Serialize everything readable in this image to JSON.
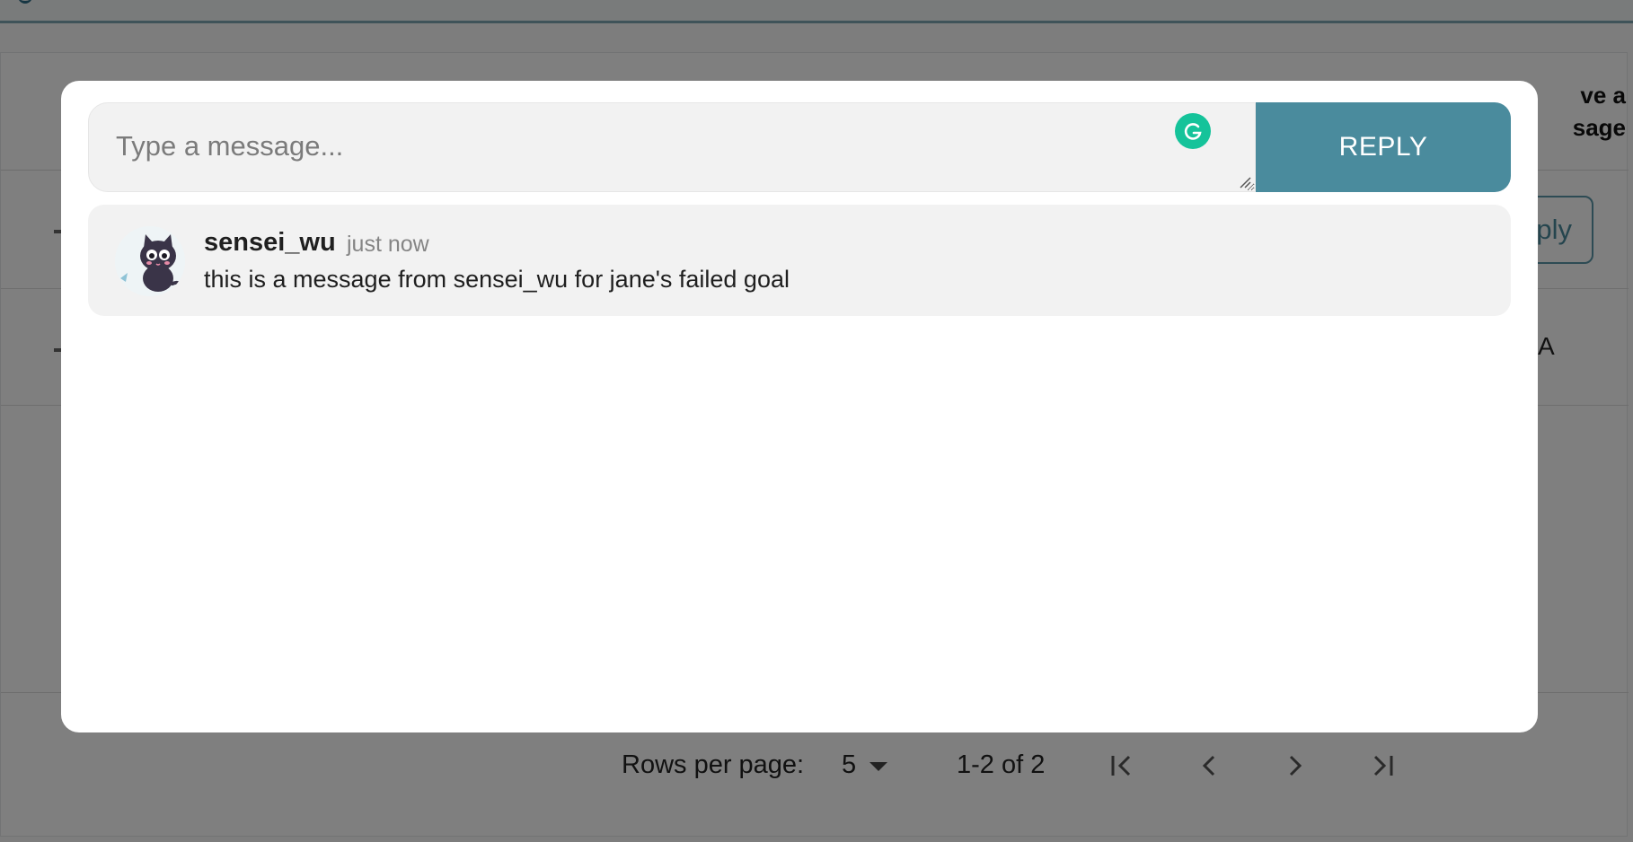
{
  "background": {
    "header_text": "ve a\nsage",
    "row_action_label": "ply",
    "row_cell_value": "A",
    "footer": {
      "rows_per_page_label": "Rows per page:",
      "rows_per_page_value": "5",
      "range_label": "1-2 of 2",
      "pager_icons": [
        "first-page-icon",
        "previous-page-icon",
        "next-page-icon",
        "last-page-icon"
      ]
    }
  },
  "modal": {
    "composer": {
      "placeholder": "Type a message...",
      "value": "",
      "reply_label": "REPLY",
      "grammarly_icon": "grammarly-icon"
    },
    "messages": [
      {
        "author": "sensei_wu",
        "time": "just now",
        "text": "this is a message from sensei_wu for jane's failed goal",
        "avatar_icon": "cat-avatar-icon"
      }
    ]
  },
  "colors": {
    "accent": "#4a8b9d",
    "backdrop": "rgba(0,0,0,0.5)",
    "message_bg": "#f2f2f2",
    "grammarly": "#15c39a"
  }
}
